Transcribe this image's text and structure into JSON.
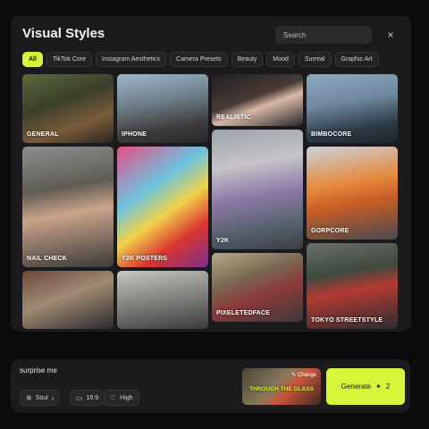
{
  "modal": {
    "title": "Visual Styles",
    "search_placeholder": "Search",
    "close_glyph": "×",
    "categories": [
      "All",
      "TikTok Core",
      "Instagram Aesthetics",
      "Camera Presets",
      "Beauty",
      "Mood",
      "Surreal",
      "Graphic Art"
    ],
    "active_category": "All",
    "styles": [
      {
        "label": "GENERAL"
      },
      {
        "label": "NAIL CHECK"
      },
      {
        "label": ""
      },
      {
        "label": "IPHONE"
      },
      {
        "label": "Y2K POSTERS"
      },
      {
        "label": ""
      },
      {
        "label": "REALISTIC"
      },
      {
        "label": "Y2K"
      },
      {
        "label": "PIXELETEDFACE"
      },
      {
        "label": "BIMBOCORE"
      },
      {
        "label": "GORPCORE"
      },
      {
        "label": "TOKYO STREETSTYLE"
      }
    ]
  },
  "composer": {
    "prompt": "surprise me",
    "model_label": "Soul",
    "aspect_label": "16:9",
    "quality_label": "High",
    "selected_style": "THROUGH THE GLASS",
    "change_label": "Change",
    "generate_label": "Generate",
    "generate_cost": "2"
  },
  "colors": {
    "accent": "#d8f53a",
    "modal_bg": "#1b1b1d",
    "page_bg": "#0b0b0c"
  }
}
